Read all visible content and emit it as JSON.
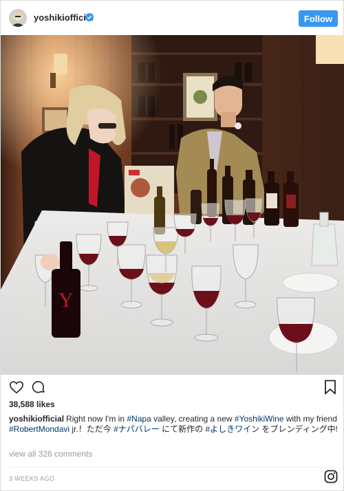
{
  "post": {
    "username": "yoshikiofficial",
    "verified": true,
    "follow_label": "Follow"
  },
  "photo": {
    "bottle_label": "Y"
  },
  "actions": {
    "icons": [
      "heart-icon",
      "comment-icon",
      "bookmark-icon"
    ]
  },
  "likes": "38,588 likes",
  "caption": {
    "username": "yoshikiofficial",
    "text_1": "Right now I'm in ",
    "tag_1": "#Napa",
    "text_2": " valley, creating a new ",
    "tag_2": "#YoshikiWine",
    "text_3": " with my friend ",
    "tag_3": "#RobertMondavi",
    "text_4": " jr.！ただ今 ",
    "tag_4": "#ナパバレー",
    "text_5": " にて新作の ",
    "tag_5": "#よしきワイン",
    "text_6": " をブレンディング中!"
  },
  "view_all_comments": "view all 326 comments",
  "timestamp": "3 WEEKS AGO",
  "colors": {
    "accent": "#3897f0",
    "hashtag": "#003569",
    "wine": "#6b0f1a"
  }
}
